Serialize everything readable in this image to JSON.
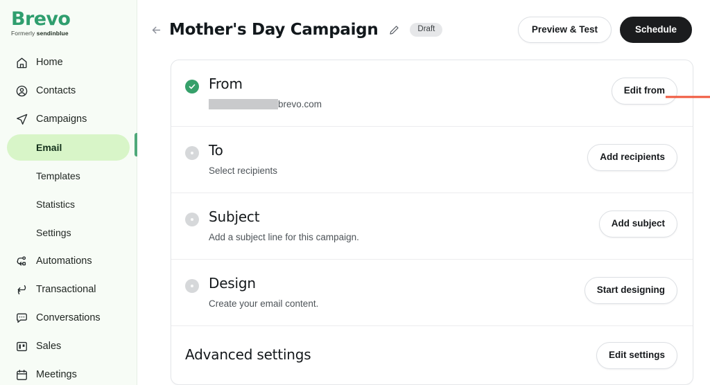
{
  "sidebar": {
    "brand": {
      "name": "Brevo",
      "tagline_prefix": "Formerly ",
      "tagline_brand": "sendinblue"
    },
    "items": [
      {
        "label": "Home",
        "icon": "home-icon",
        "type": "top",
        "active": false
      },
      {
        "label": "Contacts",
        "icon": "contacts-icon",
        "type": "top",
        "active": false
      },
      {
        "label": "Campaigns",
        "icon": "campaigns-paper-plane-icon",
        "type": "top",
        "active": false
      },
      {
        "label": "Email",
        "icon": "",
        "type": "sub",
        "active": true
      },
      {
        "label": "Templates",
        "icon": "",
        "type": "sub",
        "active": false
      },
      {
        "label": "Statistics",
        "icon": "",
        "type": "sub",
        "active": false
      },
      {
        "label": "Settings",
        "icon": "",
        "type": "sub",
        "active": false
      },
      {
        "label": "Automations",
        "icon": "automations-icon",
        "type": "top",
        "active": false
      },
      {
        "label": "Transactional",
        "icon": "transactional-swap-icon",
        "type": "top",
        "active": false
      },
      {
        "label": "Conversations",
        "icon": "conversations-chat-icon",
        "type": "top",
        "active": false
      },
      {
        "label": "Sales",
        "icon": "sales-board-icon",
        "type": "top",
        "active": false
      },
      {
        "label": "Meetings",
        "icon": "meetings-calendar-icon",
        "type": "top",
        "active": false
      }
    ]
  },
  "header": {
    "back_icon": "arrow-left-icon",
    "title": "Mother's Day Campaign",
    "edit_icon": "pencil-icon",
    "status_badge": "Draft",
    "preview_button": "Preview & Test",
    "schedule_button": "Schedule"
  },
  "rows": [
    {
      "title": "From",
      "subtitle_redacted": true,
      "subtitle": "brevo.com",
      "status": "complete",
      "action_label": "Edit from",
      "highlighted": true
    },
    {
      "title": "To",
      "subtitle_redacted": false,
      "subtitle": "Select recipients",
      "status": "incomplete",
      "action_label": "Add recipients",
      "highlighted": false
    },
    {
      "title": "Subject",
      "subtitle_redacted": false,
      "subtitle": "Add a subject line for this campaign.",
      "status": "incomplete",
      "action_label": "Add subject",
      "highlighted": false
    },
    {
      "title": "Design",
      "subtitle_redacted": false,
      "subtitle": "Create your email content.",
      "status": "incomplete",
      "action_label": "Start designing",
      "highlighted": false
    }
  ],
  "advanced": {
    "title": "Advanced settings",
    "action_label": "Edit settings"
  },
  "annotation": {
    "color": "#f0573c",
    "arrow_icon": "annotation-arrow-right",
    "box_target": "Edit from"
  },
  "colors": {
    "brand_green": "#2f9e6e",
    "sidebar_bg": "#f7fcf6",
    "active_item_bg": "#d8f5c8",
    "success_green": "#36a06a",
    "dark_button": "#1b1c1e",
    "annotation_red": "#f0573c"
  }
}
